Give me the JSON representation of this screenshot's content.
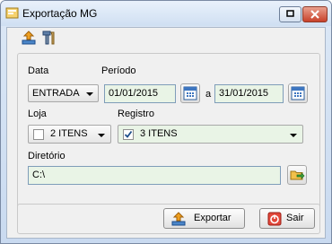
{
  "window": {
    "title": "Exportação MG"
  },
  "toolbar": {
    "icons": [
      "export-icon",
      "tools-icon"
    ]
  },
  "form": {
    "data_label": "Data",
    "data_value": "ENTRADA",
    "periodo_label": "Período",
    "date_from": "01/01/2015",
    "between_label": "a",
    "date_to": "31/01/2015",
    "loja_label": "Loja",
    "loja_value": "2 ITENS",
    "loja_checked": false,
    "registro_label": "Registro",
    "registro_value": "3 ITENS",
    "registro_checked": true,
    "diretorio_label": "Diretório",
    "diretorio_value": "C:\\"
  },
  "actions": {
    "export_label": "Exportar",
    "exit_label": "Sair"
  }
}
